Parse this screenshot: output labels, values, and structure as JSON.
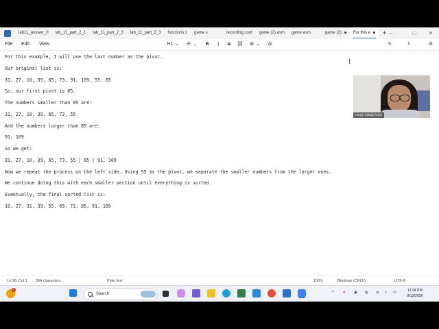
{
  "tabs": [
    {
      "label": "lab11_answer_0",
      "active": false
    },
    {
      "label": "lab_11_part_2_1",
      "active": false
    },
    {
      "label": "lab_11_part_2_3",
      "active": false
    },
    {
      "label": "lab_11_part_2_3",
      "active": false
    },
    {
      "label": "functions.s",
      "active": false
    },
    {
      "label": "game.s",
      "active": false
    },
    {
      "label": "recording.conf",
      "active": false
    },
    {
      "label": "game (2).asm",
      "active": false
    },
    {
      "label": "game.asm",
      "active": false
    },
    {
      "label": "game (2)",
      "active": false
    },
    {
      "label": "For this e",
      "active": true
    }
  ],
  "new_tab_label": "+",
  "window_controls": {
    "minimize": "–",
    "maximize": "□",
    "close": "✕"
  },
  "menu": {
    "file": "File",
    "edit": "Edit",
    "view": "View"
  },
  "toolbar": {
    "heading": "H1",
    "heading_chevron": "⌄",
    "list": "☰",
    "list_chevron": "⌄",
    "bold": "B",
    "italic": "I",
    "strikethrough": "S",
    "link": "⛓",
    "table": "⊞",
    "table_chevron": "⌄",
    "clear_format": "A̸"
  },
  "right_toolbar": {
    "copilot": "✎",
    "share": "⇪",
    "gear": "⚙"
  },
  "document": {
    "lines": [
      "For this example, I will use the last number as the pivot.",
      "Our original list is:",
      "31, 27, 10, 39, 65, 73, 91, 109, 55, 85",
      "So, our first pivot is 85.",
      "The numbers smaller than 85 are:",
      "31, 27, 10, 39, 65, 73, 55",
      "And the numbers larger than 85 are:",
      "91, 109",
      "So we get:",
      "31, 27, 10, 39, 65, 73, 55 | 85 | 91, 109",
      "Now we repeat the process on the left side. Using 55 as the pivot, we separate the smaller numbers from the larger ones.",
      "We continue doing this with each smaller section until everything is sorted.",
      "Eventually, the final sorted list is:",
      "10, 27, 31, 39, 55, 65, 73, 85, 91, 109"
    ]
  },
  "webcam": {
    "name": "Farzin Fahad Achal"
  },
  "statusbar": {
    "position": "Ln 28, Col 1",
    "characters": "394 characters",
    "format": "Plain text",
    "zoom": "100%",
    "line_ending": "Windows (CRLF)",
    "encoding": "UTF-8"
  },
  "taskbar": {
    "search_label": "Search",
    "notification_count": "1",
    "time": "11:34 PM",
    "date": "9/13/2026"
  },
  "colors": {
    "accent": "#1a5fb4",
    "tab_bar": "#f3f3f3",
    "taskbar": "#eef1f6"
  }
}
